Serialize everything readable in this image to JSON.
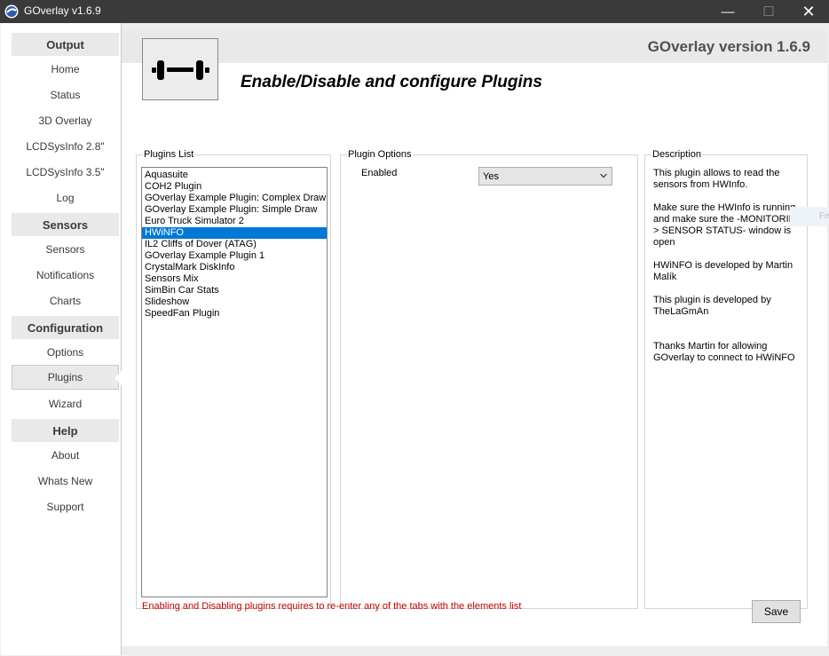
{
  "window": {
    "title": "GOverlay v1.6.9",
    "controls": {
      "minimize": "—",
      "maximize": "☐",
      "close": "✕"
    }
  },
  "sidebar": {
    "sections": [
      {
        "header": "Output",
        "items": [
          "Home",
          "Status",
          "3D Overlay",
          "LCDSysInfo 2.8\"",
          "LCDSysInfo 3.5\"",
          "Log"
        ]
      },
      {
        "header": "Sensors",
        "items": [
          "Sensors",
          "Notifications",
          "Charts"
        ]
      },
      {
        "header": "Configuration",
        "items": [
          "Options",
          "Plugins",
          "Wizard"
        ]
      },
      {
        "header": "Help",
        "items": [
          "About",
          "Whats New",
          "Support"
        ]
      }
    ],
    "active_item": "Plugins"
  },
  "header": {
    "version": "GOverlay version 1.6.9",
    "page_title": "Enable/Disable and configure Plugins",
    "logo_icon": "dumbbell-icon"
  },
  "plugins_list": {
    "legend": "Plugins List",
    "items": [
      "Aquasuite",
      "COH2 Plugin",
      "GOverlay Example Plugin: Complex Draw",
      "GOverlay Example Plugin: Simple Draw",
      "Euro Truck Simulator 2",
      "HWiNFO",
      "IL2 Cliffs of Dover (ATAG)",
      "GOverlay Example Plugin 1",
      "CrystalMark DiskInfo",
      "Sensors Mix",
      "SimBin Car Stats",
      "Slideshow",
      "SpeedFan Plugin"
    ],
    "selected_index": 5
  },
  "plugin_options": {
    "legend": "Plugin Options",
    "enabled_label": "Enabled",
    "enabled_value": "Yes"
  },
  "description": {
    "legend": "Description",
    "paragraphs": [
      "This plugin allows to read the sensors from HWInfo.",
      "Make sure the HWInfo is running. and make sure the -MONITORING > SENSOR STATUS- window is open",
      "HWiNFO is developed by Martin Malík",
      "This plugin is developed by TheLaGmAn",
      "Thanks Martin for allowing GOverlay to connect to HWiNFO"
    ]
  },
  "footer": {
    "note": "Enabling and Disabling plugins requires to re-enter any of the tabs with the elements list",
    "save_label": "Save"
  },
  "edge_tab": "Fe",
  "colors": {
    "selection": "#0078d7",
    "warning_text": "#c00000",
    "titlebar": "#3a3a3a"
  }
}
